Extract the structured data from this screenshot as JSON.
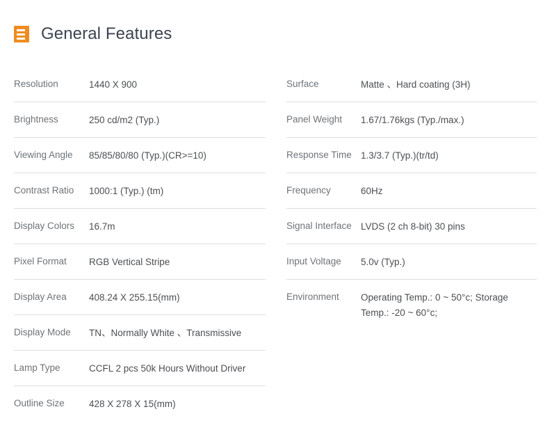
{
  "header": {
    "icon": "list-document-icon",
    "icon_color": "#ee8c22",
    "title": "General Features",
    "title_color": "#3d4450"
  },
  "colors": {
    "label": "#6e7378",
    "value": "#4b4f53",
    "divider": "#dddddd",
    "background": "#ffffff",
    "accent": "#ee8c22"
  },
  "specs": {
    "left_column": [
      {
        "label": "Resolution",
        "value": "1440 X 900"
      },
      {
        "label": "Brightness",
        "value": "250 cd/m2 (Typ.)"
      },
      {
        "label": "Viewing Angle",
        "value": "85/85/80/80 (Typ.)(CR>=10)"
      },
      {
        "label": "Contrast Ratio",
        "value": "1000:1 (Typ.) (tm)"
      },
      {
        "label": "Display Colors",
        "value": "16.7m"
      },
      {
        "label": "Pixel Format",
        "value": "RGB Vertical Stripe"
      },
      {
        "label": "Display Area",
        "value": "408.24 X 255.15(mm)"
      },
      {
        "label": "Display Mode",
        "value": "TN、Normally White 、Transmissive"
      },
      {
        "label": "Lamp Type",
        "value": "CCFL 2 pcs 50k Hours Without Driver"
      },
      {
        "label": "Outline Size",
        "value": "428 X 278 X 15(mm)"
      }
    ],
    "right_column": [
      {
        "label": "Surface",
        "value": "Matte 、Hard coating (3H)"
      },
      {
        "label": "Panel Weight",
        "value": "1.67/1.76kgs (Typ./max.)"
      },
      {
        "label": "Response Time",
        "value": "1.3/3.7 (Typ.)(tr/td)"
      },
      {
        "label": "Frequency",
        "value": "60Hz"
      },
      {
        "label": "Signal Interface",
        "value": "LVDS (2 ch 8-bit) 30 pins"
      },
      {
        "label": "Input Voltage",
        "value": "5.0v (Typ.)"
      },
      {
        "label": "Environment",
        "value": "Operating Temp.: 0 ~ 50°c; Storage Temp.: -20 ~ 60°c;"
      }
    ]
  }
}
